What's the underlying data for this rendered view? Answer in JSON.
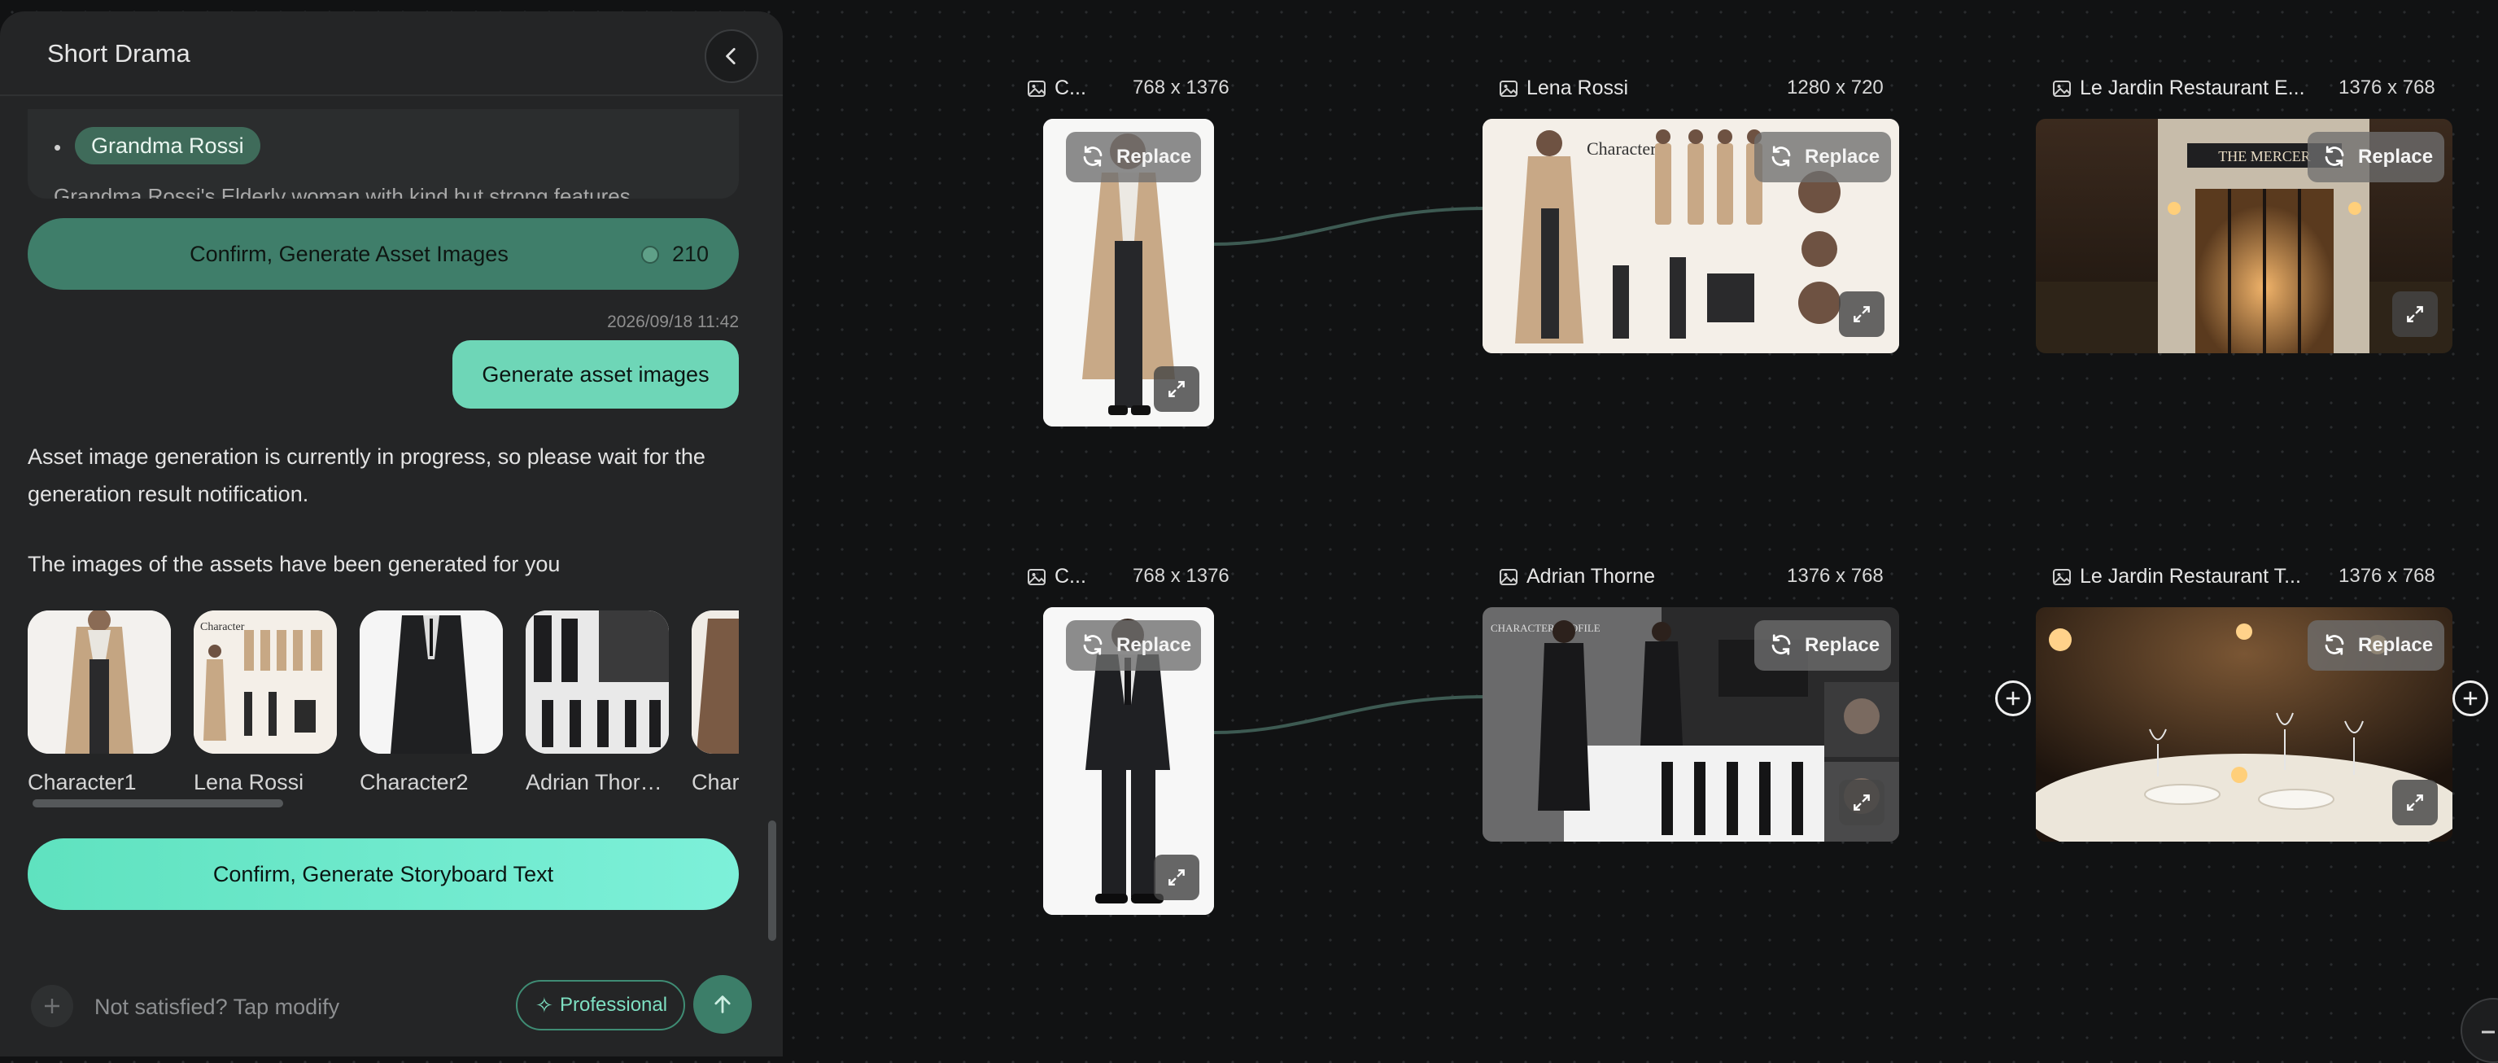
{
  "panel": {
    "title": "Short Drama",
    "back_icon": "chevron-left-icon",
    "card": {
      "bullet": "•",
      "tag": "Grandma Rossi",
      "cut_text": "Grandma Rossi's Elderly woman with kind but strong features"
    },
    "confirm_assets": {
      "label": "Confirm, Generate Asset Images",
      "cost": "210",
      "cost_icon": "coin-icon"
    },
    "timestamp": "2026/09/18 11:42",
    "user_message": "Generate asset images",
    "reply1": "Asset image generation is currently in progress, so please wait for the generation result notification.",
    "reply2": "The images of the assets have been generated for you",
    "thumbnails": [
      {
        "label": "Character1"
      },
      {
        "label": "Lena Rossi"
      },
      {
        "label": "Character2"
      },
      {
        "label": "Adrian Thor…"
      },
      {
        "label": "Chara"
      }
    ],
    "confirm_story": "Confirm, Generate Storyboard Text",
    "input": {
      "placeholder": "Not satisfied? Tap modify",
      "value": ""
    },
    "professional_label": "Professional",
    "send_icon": "arrow-up-icon",
    "plus_icon": "plus-icon"
  },
  "canvas": {
    "nodes": [
      {
        "title": "C...",
        "dims": "768 x 1376",
        "replace_label": "Replace"
      },
      {
        "title": "Lena Rossi",
        "dims": "1280 x 720",
        "replace_label": "Replace",
        "sheet_text": "Character"
      },
      {
        "title": "Le Jardin Restaurant E...",
        "dims": "1376 x 768",
        "replace_label": "Replace",
        "sign_text": "THE MERCER"
      },
      {
        "title": "C...",
        "dims": "768 x 1376",
        "replace_label": "Replace"
      },
      {
        "title": "Adrian Thorne",
        "dims": "1376 x 768",
        "replace_label": "Replace",
        "sheet_text": "CHARACTER PROFILE"
      },
      {
        "title": "Le Jardin Restaurant T...",
        "dims": "1376 x 768",
        "replace_label": "Replace"
      }
    ],
    "icons": {
      "image": "image-icon",
      "replace": "refresh-icon",
      "expand": "expand-icon",
      "add": "plus-circle-icon"
    }
  },
  "colors": {
    "accent": "#6ed6b7",
    "accent_dark": "#3f7e6a",
    "panel_bg": "#242526",
    "canvas_bg": "#111213"
  }
}
